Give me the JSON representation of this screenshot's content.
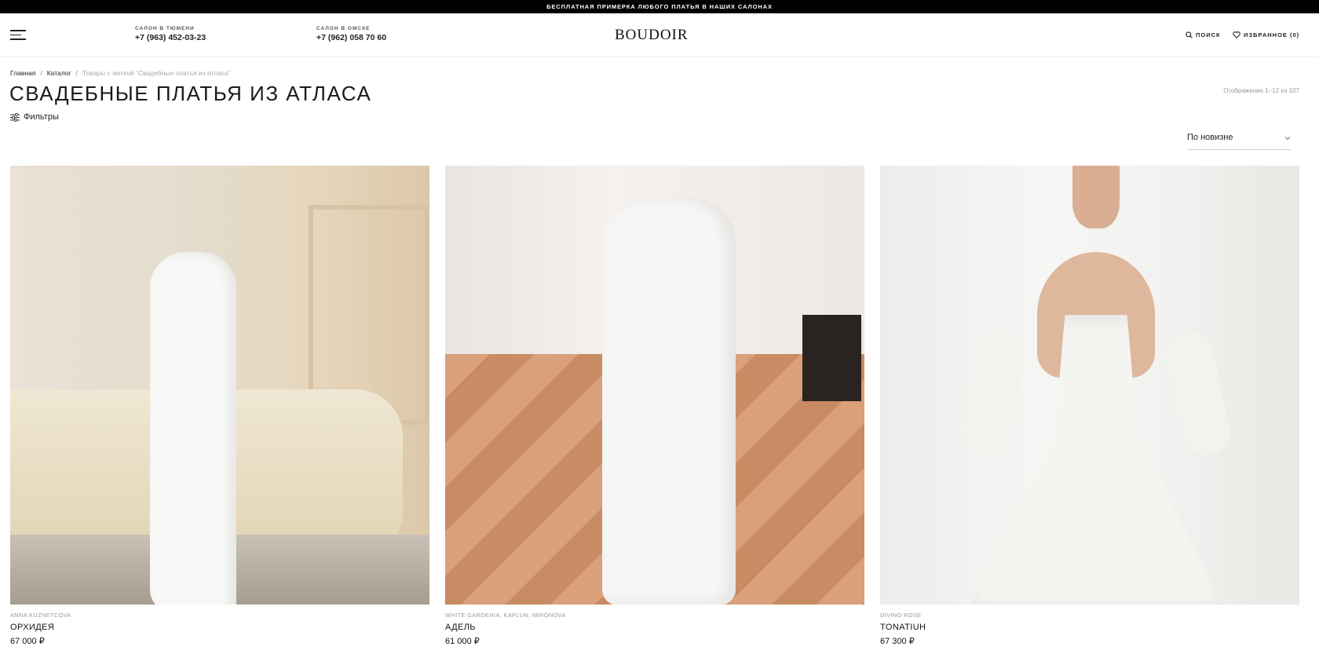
{
  "promo": {
    "text": "БЕСПЛАТНАЯ ПРИМЕРКА ЛЮБОГО ПЛАТЬЯ В НАШИХ САЛОНАХ"
  },
  "header": {
    "salons": [
      {
        "label": "САЛОН В ТЮМЕНИ",
        "phone": "+7 (963) 452-03-23"
      },
      {
        "label": "САЛОН В ОМСКЕ",
        "phone": "+7 (962) 058 70 60"
      }
    ],
    "logo": "BOUDOIR",
    "search_label": "ПОИСК",
    "favorites_label": "ИЗБРАННОЕ (0)"
  },
  "breadcrumb": {
    "home": "Главная",
    "catalog": "Каталог",
    "current": "Товары с меткой “Свадебные платья из атласа”",
    "separator": "/"
  },
  "page": {
    "title": "СВАДЕБНЫЕ ПЛАТЬЯ ИЗ АТЛАСА",
    "result_count": "Отображение 1–12 из 107",
    "filters_label": "Фильтры",
    "sort_label": "По новизне"
  },
  "products": [
    {
      "brand": "ANNA KUZNETCOVA",
      "name": "ОРХИДЕЯ",
      "price": "67 000 ₽"
    },
    {
      "brand": "WHITE GARDENIA, KAPLUN, MIRONOVA",
      "name": "АДЕЛЬ",
      "price": "61 000 ₽"
    },
    {
      "brand": "DIVINO ROSE",
      "name": "TONATIUH",
      "price": "67 300 ₽"
    }
  ],
  "icons": {
    "menu": "hamburger-icon",
    "search": "search-icon",
    "favorites": "heart-icon",
    "filters": "sliders-icon",
    "sort": "chevron-down-icon"
  }
}
